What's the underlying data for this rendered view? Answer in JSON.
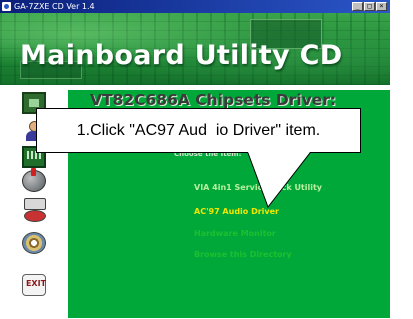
{
  "window": {
    "title": "GA-7ZXE CD Ver 1.4",
    "buttons": [
      "_",
      "□",
      "×"
    ]
  },
  "banner": {
    "title": "Mainboard Utility CD"
  },
  "content": {
    "chipset_heading": "VT82C686A Chipsets Driver:",
    "section_heading": "Choose the Item:",
    "menu": [
      {
        "label": "VIA 4in1 Service Pack Utility",
        "color": "#b8f0a0"
      },
      {
        "label": "AC'97 Audio Driver",
        "color": "#f0e800"
      },
      {
        "label": "Hardware Monitor",
        "color": "#1cc02e"
      },
      {
        "label": "Browse this Directory",
        "color": "#1cc02e"
      }
    ]
  },
  "sidebar": {
    "icons": [
      "motherboard-icon",
      "person-icon",
      "chip-icon",
      "globe-icon",
      "manual-icon",
      "cd-icon",
      "exit-icon"
    ],
    "exit_label": "EXIT"
  },
  "callout": {
    "text": "1.Click \"AC97 Aud  io Driver\" item."
  },
  "colors": {
    "background": "#00a83a",
    "selected": "#f0e800",
    "titlebar": "#0a1f7a"
  }
}
